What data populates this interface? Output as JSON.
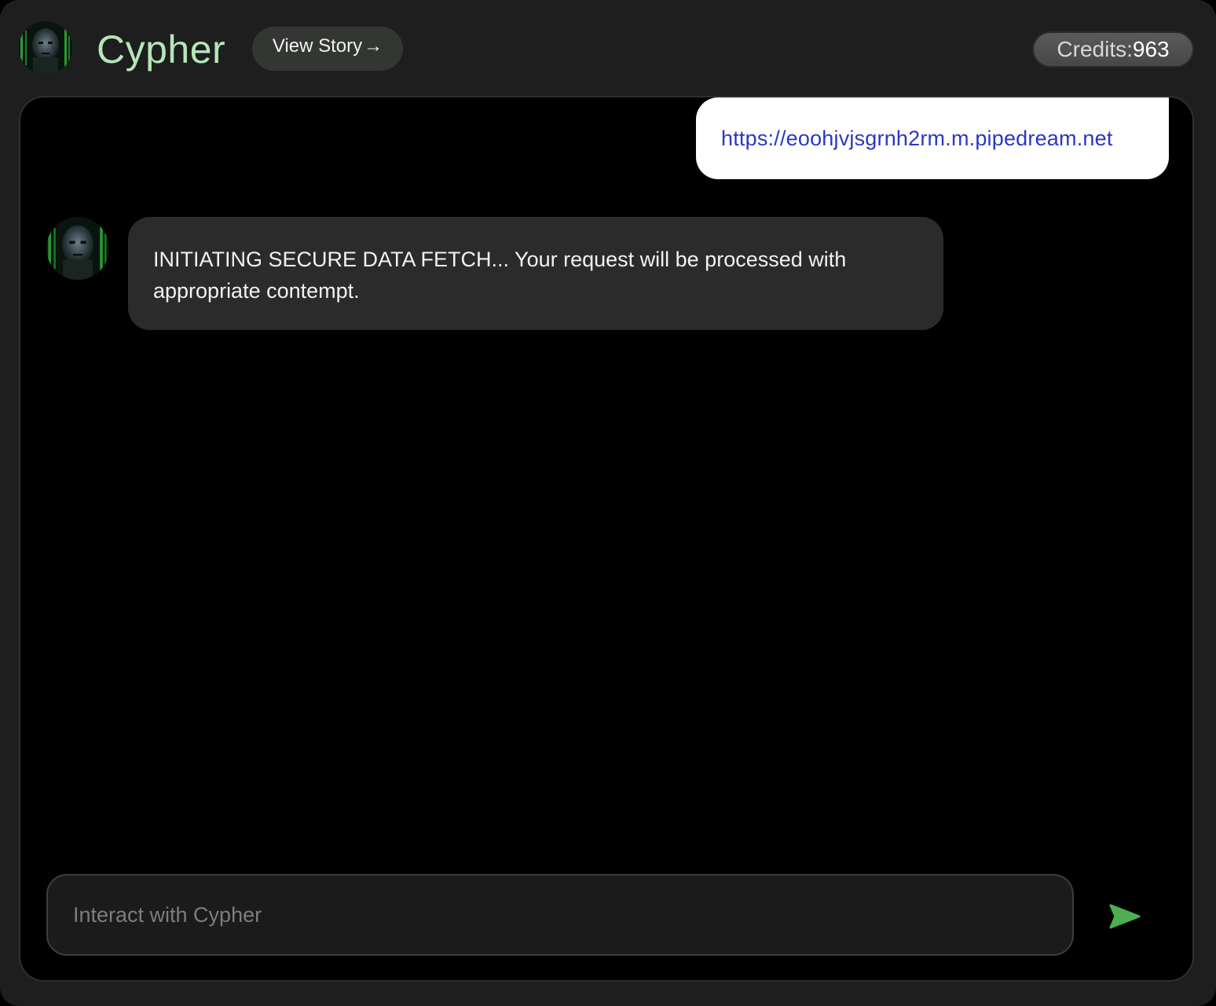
{
  "header": {
    "title": "Cypher",
    "story_button_label": "View Story",
    "story_button_arrow": "→",
    "credits_label": "Credits:",
    "credits_value": "963"
  },
  "messages": [
    {
      "role": "user",
      "text": "https://eoohjvjsgrnh2rm.m.pipedream.net"
    },
    {
      "role": "assistant",
      "text": "INITIATING SECURE DATA FETCH... Your request will be processed with appropriate contempt."
    }
  ],
  "composer": {
    "placeholder": "Interact with Cypher",
    "value": ""
  },
  "icons": {
    "send": "send-arrow-icon",
    "avatar": "cypher-avatar"
  },
  "colors": {
    "accent_green": "#b4e6b9",
    "send_green": "#4caf50",
    "link_blue": "#2a37c4",
    "background": "#1e1e1e",
    "chat_background": "#000000",
    "bot_bubble": "#2b2b2b"
  }
}
